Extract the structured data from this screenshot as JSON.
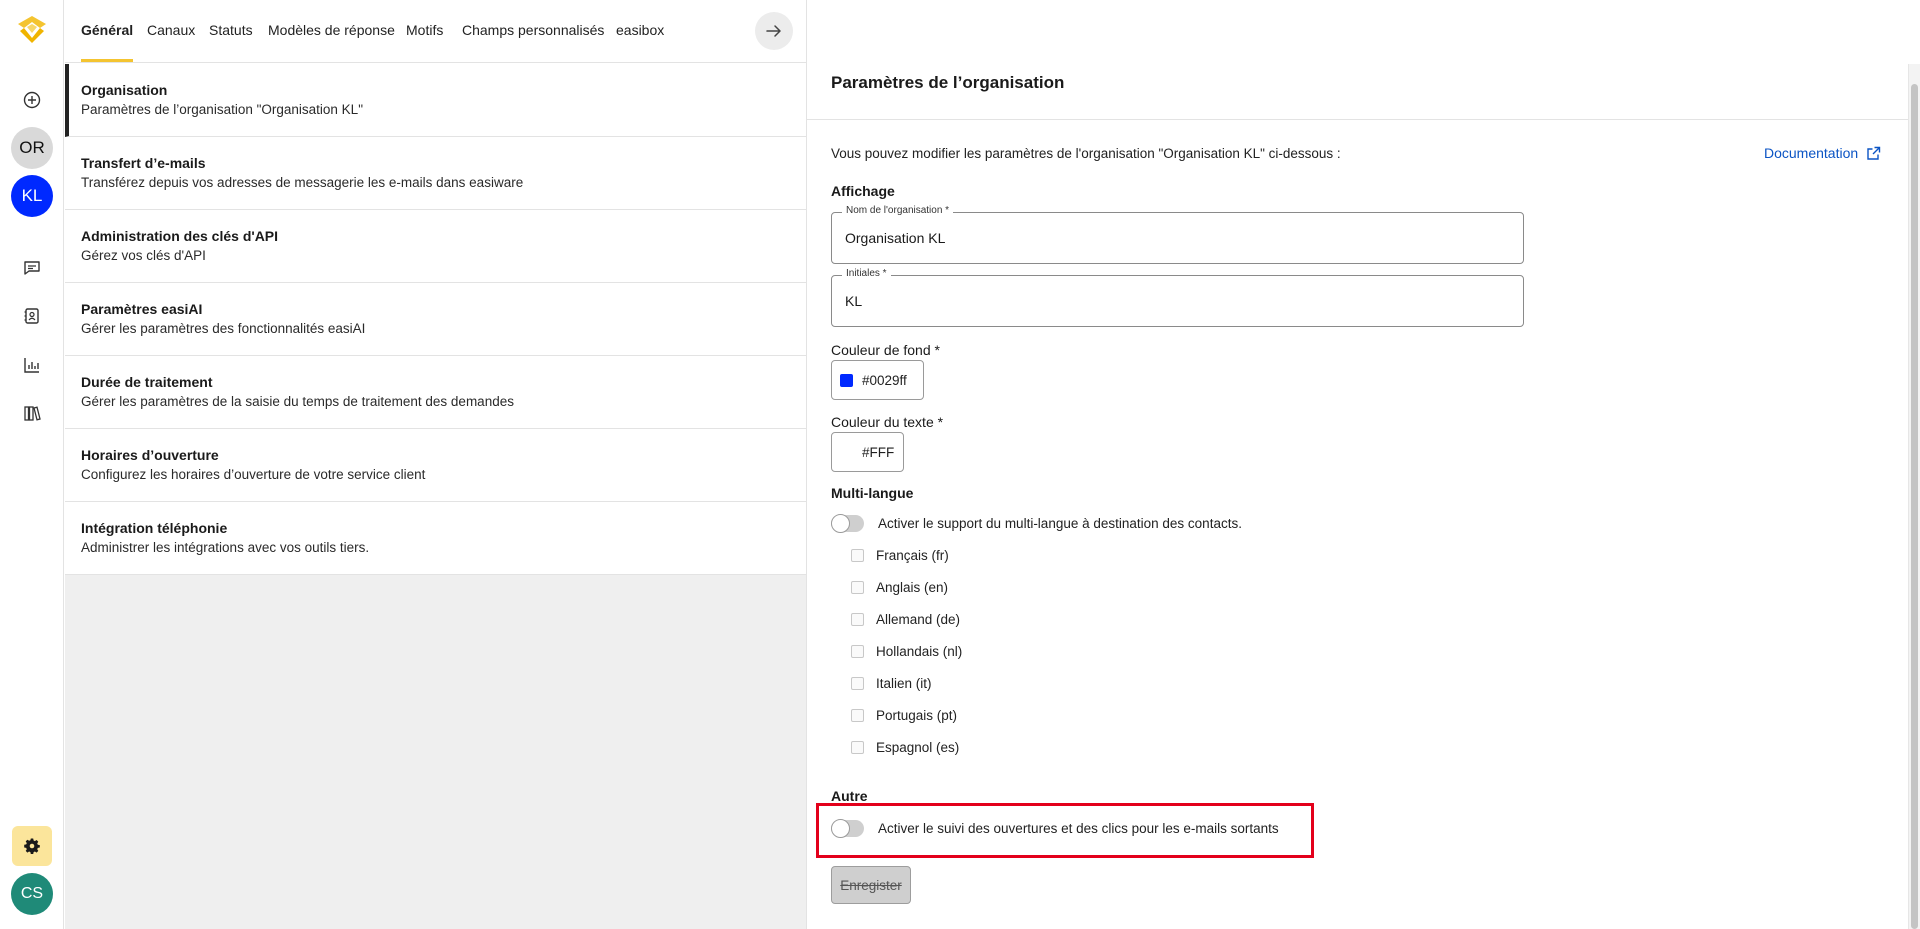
{
  "rail": {
    "avatars": {
      "org": "OR",
      "org_active": "KL",
      "user": "CS"
    },
    "colors": {
      "org_bg": "#d9d9d9",
      "org_active_bg": "#0029ff",
      "user_bg": "#1f8a78",
      "settings_bg": "#fbe59b"
    },
    "icons": [
      "plus-circle-icon",
      "chat-icon",
      "contacts-icon",
      "chart-icon",
      "library-icon",
      "gear-icon"
    ]
  },
  "tabs": [
    {
      "label": "Général",
      "active": true
    },
    {
      "label": "Canaux"
    },
    {
      "label": "Statuts"
    },
    {
      "label": "Modèles de réponse"
    },
    {
      "label": "Motifs"
    },
    {
      "label": "Champs personnalisés"
    },
    {
      "label": "easibox"
    }
  ],
  "menu": [
    {
      "title": "Organisation",
      "subtitle": "Paramètres de l’organisation \"Organisation KL\"",
      "active": true
    },
    {
      "title": "Transfert d’e-mails",
      "subtitle": "Transférez depuis vos adresses de messagerie les e-mails dans easiware"
    },
    {
      "title": "Administration des clés d'API",
      "subtitle": "Gérez vos clés d'API"
    },
    {
      "title": "Paramètres easiAI",
      "subtitle": "Gérer les paramètres des fonctionnalités easiAI"
    },
    {
      "title": "Durée de traitement",
      "subtitle": "Gérer les paramètres de la saisie du temps de traitement des demandes"
    },
    {
      "title": "Horaires d’ouverture",
      "subtitle": "Configurez les horaires d’ouverture de votre service client"
    },
    {
      "title": "Intégration téléphonie",
      "subtitle": "Administrer les intégrations avec vos outils tiers."
    }
  ],
  "panel": {
    "title": "Paramètres de l’organisation",
    "intro": "Vous pouvez modifier les paramètres de l'organisation \"Organisation KL\" ci-dessous :",
    "doc_link": "Documentation",
    "display_section": "Affichage",
    "org_name": {
      "label": "Nom de l'organisation *",
      "value": "Organisation KL"
    },
    "initials": {
      "label": "Initiales *",
      "value": "KL"
    },
    "bg_color": {
      "label": "Couleur de fond *",
      "value": "#0029ff",
      "swatch": "#0029ff"
    },
    "text_color": {
      "label": "Couleur du texte *",
      "value": "#FFF",
      "swatch": "#ffffff"
    },
    "multilang_section": "Multi-langue",
    "multilang_toggle": "Activer le support du multi-langue à destination des contacts.",
    "languages": [
      "Français (fr)",
      "Anglais (en)",
      "Allemand (de)",
      "Hollandais (nl)",
      "Italien (it)",
      "Portugais (pt)",
      "Espagnol (es)"
    ],
    "other_section": "Autre",
    "tracking_toggle": "Activer le suivi des ouvertures et des clics pour les e-mails sortants",
    "save_label": "Enregister"
  },
  "colors": {
    "accent": "#f4c430",
    "link": "#0b54c4",
    "highlight": "#e3001b"
  }
}
